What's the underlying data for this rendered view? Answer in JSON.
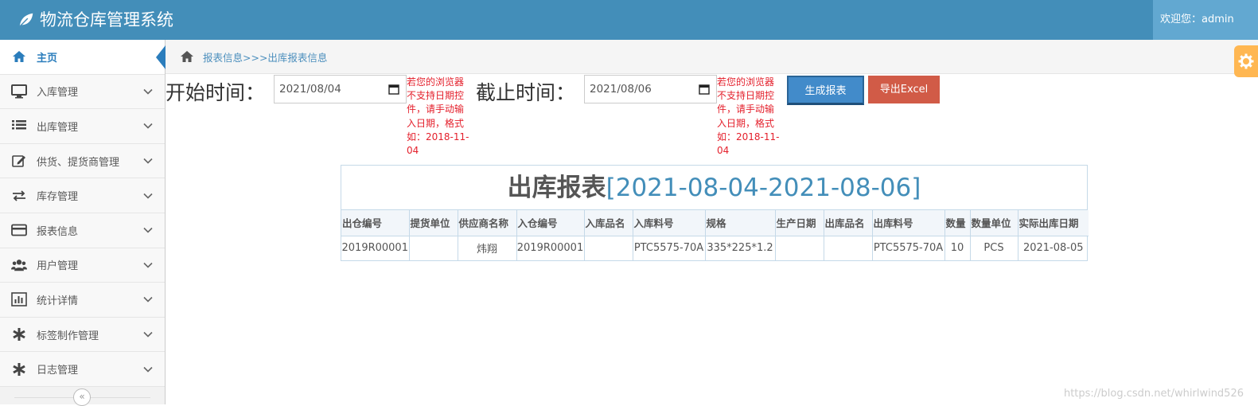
{
  "app": {
    "title": "物流仓库管理系统",
    "welcome": "欢迎您：admin"
  },
  "colors": {
    "header": "#438eb9",
    "welcome_bg": "#62a8d1",
    "accent": "#2b7dbc",
    "generate_button": "#428bca",
    "export_button": "#d15b47",
    "warning_text": "#e4202c",
    "settings_button": "#ffb752"
  },
  "sidebar": {
    "items": [
      {
        "label": "主页",
        "icon": "home-icon",
        "active": true
      },
      {
        "label": "入库管理",
        "icon": "desktop-icon"
      },
      {
        "label": "出库管理",
        "icon": "list-icon"
      },
      {
        "label": "供货、提货商管理",
        "icon": "edit-icon"
      },
      {
        "label": "库存管理",
        "icon": "exchange-icon"
      },
      {
        "label": "报表信息",
        "icon": "credit-card-icon"
      },
      {
        "label": "用户管理",
        "icon": "users-icon"
      },
      {
        "label": "统计详情",
        "icon": "bar-chart-icon"
      },
      {
        "label": "标签制作管理",
        "icon": "asterisk-icon"
      },
      {
        "label": "日志管理",
        "icon": "asterisk-icon"
      }
    ],
    "collapse_glyph": "«"
  },
  "breadcrumb": {
    "text": "报表信息>>>出库报表信息"
  },
  "filter": {
    "start_label": "开始时间：",
    "start_value": "2021/08/04",
    "end_label": "截止时间：",
    "end_value": "2021/08/06",
    "date_hint": "若您的浏览器不支持日期控件，请手动输入日期，格式如：2018-11-04",
    "generate_label": "生成报表",
    "export_label": "导出Excel"
  },
  "report": {
    "title_main": "出库报表",
    "title_range": "[2021-08-04-2021-08-06]",
    "columns": [
      "出仓编号",
      "提货单位",
      "供应商名称",
      "入仓编号",
      "入库品名",
      "入库料号",
      "规格",
      "生产日期",
      "出库品名",
      "出库料号",
      "数量",
      "数量单位",
      "实际出库日期"
    ],
    "rows": [
      [
        "2019R00001",
        "",
        "炜翔",
        "2019R00001",
        "",
        "PTC5575-70A",
        "335*225*1.2",
        "",
        "",
        "PTC5575-70A",
        "10",
        "PCS",
        "2021-08-05"
      ]
    ]
  },
  "watermark": "https://blog.csdn.net/whirlwind526"
}
